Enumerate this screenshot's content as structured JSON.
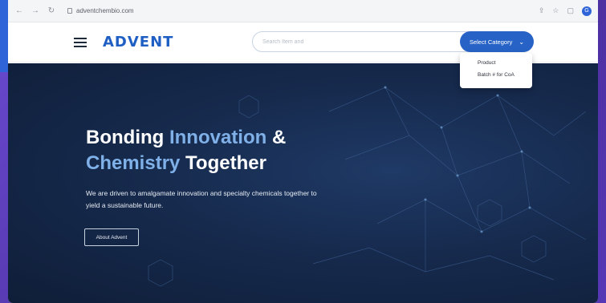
{
  "browser": {
    "url": "adventchembio.com",
    "back_icon": "arrow-left-icon",
    "forward_icon": "arrow-right-icon",
    "reload_icon": "reload-icon",
    "profile_initial": "G"
  },
  "header": {
    "logo": "ADVENT",
    "search_placeholder": "Search Item and",
    "select_label": "Select Category"
  },
  "dropdown": {
    "items": [
      "Product",
      "Batch # for CoA"
    ]
  },
  "hero": {
    "title_part1": "Bonding ",
    "title_accent1": "Innovation",
    "title_part2": " &",
    "title_accent2": "Chemistry",
    "title_part3": " Together",
    "subtitle": "We are driven to amalgamate innovation and specialty chemicals together to yield a sustainable future.",
    "cta_label": "About Advent"
  },
  "colors": {
    "brand": "#2763c6",
    "accent_text": "#7fb0e8",
    "hero_bg": "#162a4d"
  }
}
